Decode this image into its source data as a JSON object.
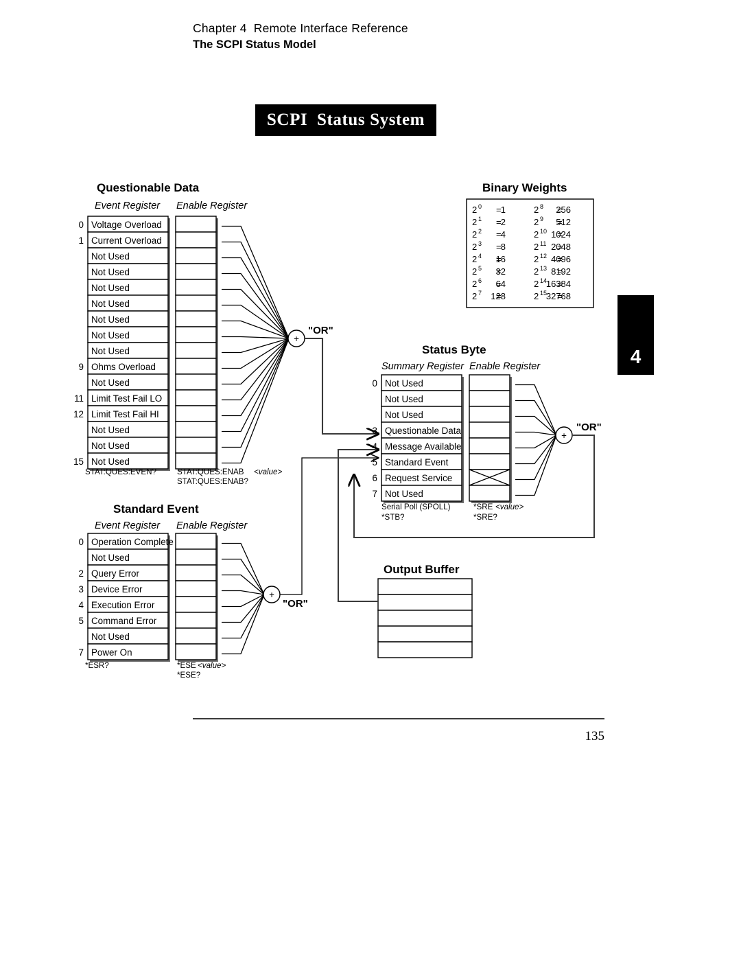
{
  "header": {
    "chapter": "Chapter 4  Remote Interface Reference",
    "section": "The SCPI Status Model"
  },
  "banner": {
    "title": "SCPI  Status System"
  },
  "chapter_tab": {
    "number": "4"
  },
  "footer": {
    "page_number": "135"
  },
  "questionable_data": {
    "title": "Questionable Data",
    "event_register_label": "Event Register",
    "enable_register_label": "Enable Register",
    "event_command": "STAT:QUES:EVEN?",
    "enable_command": "STAT:QUES:ENAB",
    "enable_command_value": "<value>",
    "enable_query": "STAT:QUES:ENAB?",
    "or_label": "\"OR\"",
    "or_symbol": "+",
    "bits": [
      {
        "bit": "0",
        "label": "Voltage Overload"
      },
      {
        "bit": "1",
        "label": "Current Overload"
      },
      {
        "bit": "",
        "label": "Not Used"
      },
      {
        "bit": "",
        "label": "Not Used"
      },
      {
        "bit": "",
        "label": "Not Used"
      },
      {
        "bit": "",
        "label": "Not Used"
      },
      {
        "bit": "",
        "label": "Not Used"
      },
      {
        "bit": "",
        "label": "Not Used"
      },
      {
        "bit": "",
        "label": "Not Used"
      },
      {
        "bit": "9",
        "label": "Ohms Overload"
      },
      {
        "bit": "",
        "label": "Not Used"
      },
      {
        "bit": "11",
        "label": "Limit Test Fail LO"
      },
      {
        "bit": "12",
        "label": "Limit Test Fail HI"
      },
      {
        "bit": "",
        "label": "Not Used"
      },
      {
        "bit": "",
        "label": "Not Used"
      },
      {
        "bit": "15",
        "label": "Not Used"
      }
    ]
  },
  "standard_event": {
    "title": "Standard Event",
    "event_register_label": "Event Register",
    "enable_register_label": "Enable Register",
    "event_command": "*ESR?",
    "enable_command": "*ESE",
    "enable_command_value": "<value>",
    "enable_query": "*ESE?",
    "or_label": "\"OR\"",
    "or_symbol": "+",
    "bits": [
      {
        "bit": "0",
        "label": "Operation Complete"
      },
      {
        "bit": "",
        "label": "Not Used"
      },
      {
        "bit": "2",
        "label": "Query Error"
      },
      {
        "bit": "3",
        "label": "Device Error"
      },
      {
        "bit": "4",
        "label": "Execution Error"
      },
      {
        "bit": "5",
        "label": "Command Error"
      },
      {
        "bit": "",
        "label": "Not Used"
      },
      {
        "bit": "7",
        "label": "Power On"
      }
    ]
  },
  "status_byte": {
    "title": "Status Byte",
    "summary_register_label": "Summary Register",
    "enable_register_label": "Enable Register",
    "summary_command": "Serial Poll (SPOLL)",
    "summary_query": "*STB?",
    "enable_command": "*SRE",
    "enable_command_value": "<value>",
    "enable_query": "*SRE?",
    "or_label": "\"OR\"",
    "or_symbol": "+",
    "bits": [
      {
        "bit": "0",
        "label": "Not Used"
      },
      {
        "bit": "",
        "label": "Not Used"
      },
      {
        "bit": "",
        "label": "Not Used"
      },
      {
        "bit": "3",
        "label": "Questionable Data"
      },
      {
        "bit": "4",
        "label": "Message Available"
      },
      {
        "bit": "5",
        "label": "Standard Event"
      },
      {
        "bit": "6",
        "label": "Request Service"
      },
      {
        "bit": "7",
        "label": "Not Used"
      }
    ]
  },
  "output_buffer": {
    "title": "Output Buffer",
    "rows": [
      "",
      "",
      "",
      "",
      ""
    ]
  },
  "binary_weights": {
    "title": "Binary Weights",
    "rows": [
      {
        "exp_left": "0",
        "val_left": "1",
        "exp_right": "8",
        "val_right": "256"
      },
      {
        "exp_left": "1",
        "val_left": "2",
        "exp_right": "9",
        "val_right": "512"
      },
      {
        "exp_left": "2",
        "val_left": "4",
        "exp_right": "10",
        "val_right": "1024"
      },
      {
        "exp_left": "3",
        "val_left": "8",
        "exp_right": "11",
        "val_right": "2048"
      },
      {
        "exp_left": "4",
        "val_left": "16",
        "exp_right": "12",
        "val_right": "4096"
      },
      {
        "exp_left": "5",
        "val_left": "32",
        "exp_right": "13",
        "val_right": "8192"
      },
      {
        "exp_left": "6",
        "val_left": "64",
        "exp_right": "14",
        "val_right": "16384"
      },
      {
        "exp_left": "7",
        "val_left": "128",
        "exp_right": "15",
        "val_right": "32768"
      }
    ],
    "base": "2",
    "equals": "="
  }
}
